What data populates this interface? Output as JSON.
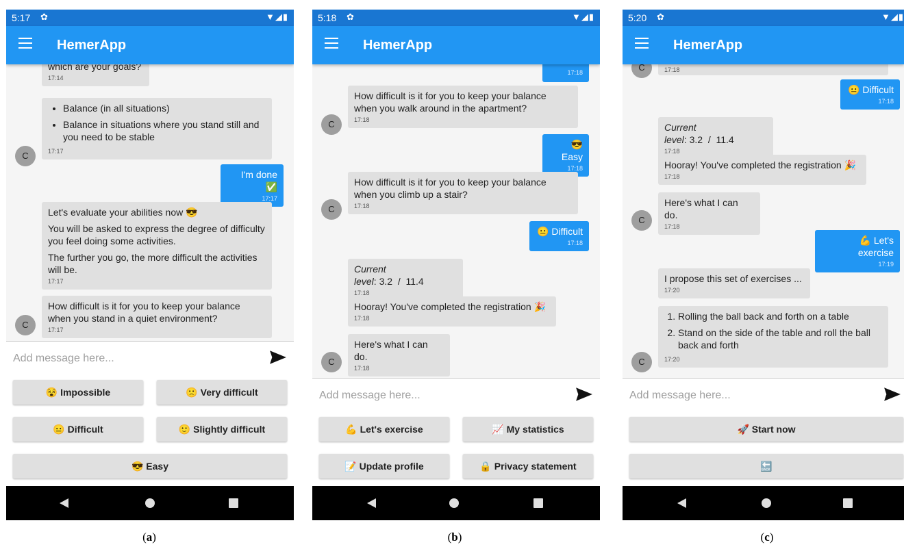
{
  "app": {
    "title": "HemerApp",
    "input_placeholder": "Add message here...",
    "status_icons": "▼◢▮"
  },
  "panels": [
    {
      "caption_prefix": "(",
      "caption_letter": "a",
      "caption_suffix": ")",
      "status_time": "5:17",
      "messages": {
        "top_partial": "which are your goals?",
        "top_partial_time": "17:14",
        "goals_item1": "Balance (in all situations)",
        "goals_item2": "Balance in situations where you stand still and you need to be stable",
        "goals_time": "17:17",
        "user_done": "I'm done ✅",
        "user_done_time": "17:17",
        "eval_p1": "Let's evaluate your abilities now 😎",
        "eval_p2": "You will be asked to express the degree of difficulty you feel doing some activities.",
        "eval_p3": "The further you go, the more difficult the activities will be.",
        "eval_time": "17:17",
        "q_quiet": "How difficult is it for you to keep your balance when you stand in a quiet environment?",
        "q_quiet_time": "17:17"
      },
      "avatar": "C",
      "buttons": {
        "impossible": "😵 Impossible",
        "very_difficult": "🙁 Very difficult",
        "difficult": "😐 Difficult",
        "slightly_difficult": "🙂 Slightly difficult",
        "easy": "😎 Easy"
      }
    },
    {
      "caption_prefix": "(",
      "caption_letter": "b",
      "caption_suffix": ")",
      "status_time": "5:18",
      "messages": {
        "top_partial_time": "17:18",
        "q_apartment": "How difficult is it for you to keep your balance when you walk around in the apartment?",
        "q_apartment_time": "17:18",
        "user_easy": "😎 Easy",
        "user_easy_time": "17:18",
        "q_stair": "How difficult is it for you to keep your balance when you climb up a stair?",
        "q_stair_time": "17:18",
        "user_difficult": "😐 Difficult",
        "user_difficult_time": "17:18",
        "level_label": "Current level",
        "level_value": ": 3.2  /  11.4",
        "level_time": "17:18",
        "hooray": "Hooray! You've completed the registration 🎉",
        "hooray_time": "17:18",
        "can_do": "Here's what I can do.",
        "can_do_time": "17:18"
      },
      "avatar": "C",
      "buttons": {
        "lets_exercise": "💪 Let's exercise",
        "my_statistics": "📈 My statistics",
        "update_profile": "📝 Update profile",
        "privacy": "🔒 Privacy statement"
      }
    },
    {
      "caption_prefix": "(",
      "caption_letter": "c",
      "caption_suffix": ")",
      "status_time": "5:20",
      "messages": {
        "top_partial_time": "17:18",
        "user_difficult": "😐 Difficult",
        "user_difficult_time": "17:18",
        "level_label": "Current level",
        "level_value": ": 3.2  /  11.4",
        "level_time": "17:18",
        "hooray": "Hooray! You've completed the registration 🎉",
        "hooray_time": "17:18",
        "can_do": "Here's what I can do.",
        "can_do_time": "17:18",
        "user_exercise": "💪 Let's exercise",
        "user_exercise_time": "17:19",
        "propose": "I propose this set of exercises ...",
        "propose_time": "17:20",
        "ex1": "Rolling the ball back and forth on a table",
        "ex2": "Stand on the side of the table and roll the ball back and forth",
        "ex_time": "17:20"
      },
      "avatar": "C",
      "buttons": {
        "start_now": "🚀 Start now",
        "back": "🔙"
      }
    }
  ]
}
